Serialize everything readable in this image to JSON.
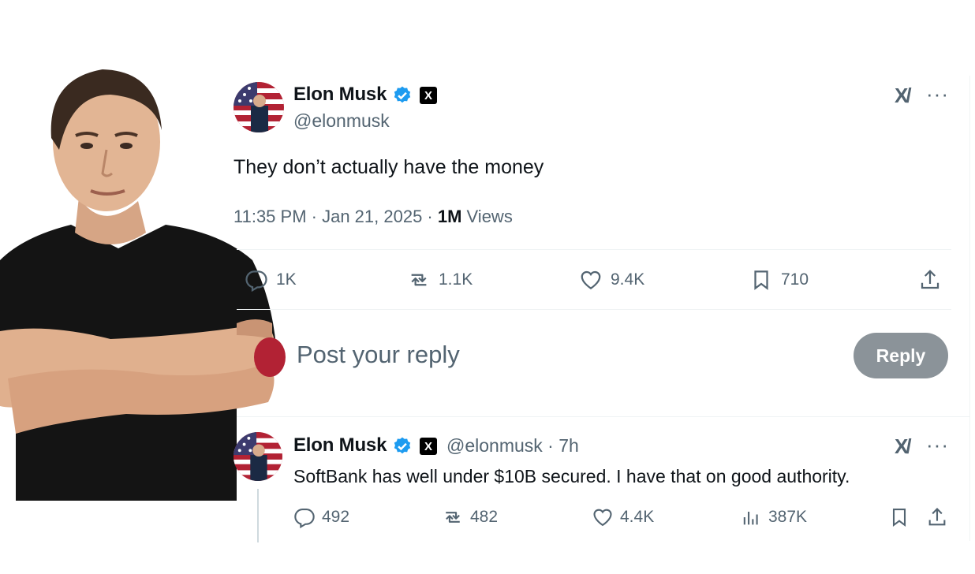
{
  "main_post": {
    "author_name": "Elon Musk",
    "handle": "@elonmusk",
    "x_badge": "X",
    "text": "They don’t actually have the money",
    "time": "11:35 PM · Jan 21, 2025 · ",
    "views_count": "1M",
    "views_label": " Views",
    "grok_label": "X/",
    "more_label": "···",
    "actions": {
      "replies": "1K",
      "reposts": "1.1K",
      "likes": "9.4K",
      "bookmarks": "710"
    }
  },
  "reply_box": {
    "placeholder": "Post your reply",
    "button_label": "Reply"
  },
  "reply_post": {
    "author_name": "Elon Musk",
    "handle_time": "@elonmusk · 7h",
    "x_badge": "X",
    "text": "SoftBank has well under $10B secured. I have that on good authority.",
    "grok_label": "X/",
    "more_label": "···",
    "actions": {
      "replies": "492",
      "reposts": "482",
      "likes": "4.4K",
      "views": "387K"
    }
  },
  "colors": {
    "text_primary": "#0f1419",
    "text_secondary": "#536471",
    "verified_blue": "#1d9bf0",
    "reply_button": "#8b9399",
    "divider": "#eff3f4"
  }
}
